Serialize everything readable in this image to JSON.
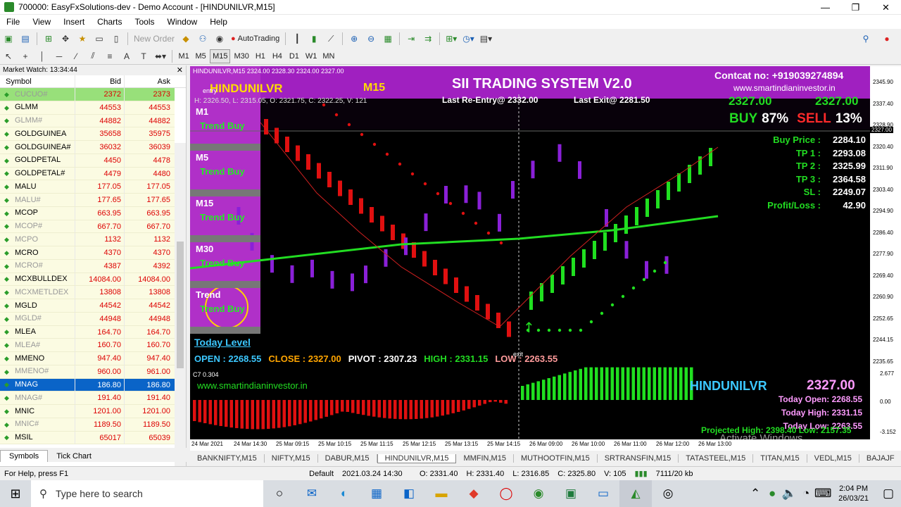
{
  "window": {
    "title": "700000: EasyFxSolutions-dev - Demo Account - [HINDUNILVR,M15]"
  },
  "menu": [
    "File",
    "View",
    "Insert",
    "Charts",
    "Tools",
    "Window",
    "Help"
  ],
  "toolbar": {
    "new_order": "New Order",
    "autotrading": "AutoTrading"
  },
  "timeframes": [
    "M1",
    "M5",
    "M15",
    "M30",
    "H1",
    "H4",
    "D1",
    "W1",
    "MN"
  ],
  "market_watch": {
    "title": "Market Watch: 13:34:44",
    "col_symbol": "Symbol",
    "col_bid": "Bid",
    "col_ask": "Ask",
    "rows": [
      {
        "s": "CUCUO#",
        "b": "2372",
        "a": "2373",
        "dim": true,
        "hl": true
      },
      {
        "s": "GLMM",
        "b": "44553",
        "a": "44553"
      },
      {
        "s": "GLMM#",
        "b": "44882",
        "a": "44882",
        "dim": true
      },
      {
        "s": "GOLDGUINEA",
        "b": "35658",
        "a": "35975"
      },
      {
        "s": "GOLDGUINEA#",
        "b": "36032",
        "a": "36039"
      },
      {
        "s": "GOLDPETAL",
        "b": "4450",
        "a": "4478"
      },
      {
        "s": "GOLDPETAL#",
        "b": "4479",
        "a": "4480"
      },
      {
        "s": "MALU",
        "b": "177.05",
        "a": "177.05"
      },
      {
        "s": "MALU#",
        "b": "177.65",
        "a": "177.65",
        "dim": true
      },
      {
        "s": "MCOP",
        "b": "663.95",
        "a": "663.95"
      },
      {
        "s": "MCOP#",
        "b": "667.70",
        "a": "667.70",
        "dim": true
      },
      {
        "s": "MCPO",
        "b": "1132",
        "a": "1132",
        "dim": true
      },
      {
        "s": "MCRO",
        "b": "4370",
        "a": "4370"
      },
      {
        "s": "MCRO#",
        "b": "4387",
        "a": "4392",
        "dim": true
      },
      {
        "s": "MCXBULLDEX",
        "b": "14084.00",
        "a": "14084.00"
      },
      {
        "s": "MCXMETLDEX",
        "b": "13808",
        "a": "13808",
        "dim": true
      },
      {
        "s": "MGLD",
        "b": "44542",
        "a": "44542"
      },
      {
        "s": "MGLD#",
        "b": "44948",
        "a": "44948",
        "dim": true
      },
      {
        "s": "MLEA",
        "b": "164.70",
        "a": "164.70"
      },
      {
        "s": "MLEA#",
        "b": "160.70",
        "a": "160.70",
        "dim": true
      },
      {
        "s": "MMENO",
        "b": "947.40",
        "a": "947.40"
      },
      {
        "s": "MMENO#",
        "b": "960.00",
        "a": "961.00",
        "dim": true
      },
      {
        "s": "MNAG",
        "b": "186.80",
        "a": "186.80",
        "sel": true
      },
      {
        "s": "MNAG#",
        "b": "191.40",
        "a": "191.40",
        "dim": true
      },
      {
        "s": "MNIC",
        "b": "1201.00",
        "a": "1201.00"
      },
      {
        "s": "MNIC#",
        "b": "1189.50",
        "a": "1189.50",
        "dim": true
      },
      {
        "s": "MSIL",
        "b": "65017",
        "a": "65039"
      }
    ],
    "tabs": [
      "Symbols",
      "Tick Chart"
    ]
  },
  "chart": {
    "header": "HINDUNILVR,M15 2324.00 2328.30 2324.00 2327.00",
    "symbol": "HINDUNILVR",
    "tf": "M15",
    "system": "SII TRADING SYSTEM V2.0",
    "contact": "Contcat no: +919039274894",
    "website": "www.smartindianinvestor.in",
    "ohlc": "H: 2326.50, L: 2315.05, O: 2321.75, C: 2322.25, V: 121",
    "reentry": "Last Re-Entry@ 2332.00",
    "exit": "Last Exit@ 2281.50",
    "price_left": "2327.00",
    "price_right": "2327.00",
    "buy_label": "BUY",
    "buy_pct": "87%",
    "sell_label": "SELL",
    "sell_pct": "13%",
    "trade": [
      {
        "k": "Buy Price :",
        "v": "2284.10"
      },
      {
        "k": "TP 1 :",
        "v": "2293.08"
      },
      {
        "k": "TP 2 :",
        "v": "2325.99"
      },
      {
        "k": "TP 3 :",
        "v": "2364.58"
      },
      {
        "k": "SL :",
        "v": "2249.07"
      },
      {
        "k": "Profit/Loss :",
        "v": "42.90"
      }
    ],
    "trend_panels": [
      {
        "tf": "M1",
        "t": "Trend Buy"
      },
      {
        "tf": "M5",
        "t": "Trend Buy"
      },
      {
        "tf": "M15",
        "t": "Trend Buy"
      },
      {
        "tf": "M30",
        "t": "Trend Buy"
      },
      {
        "tf": "Trend",
        "t": "Trend Buy"
      }
    ],
    "today_level": "Today Level",
    "open": "OPEN : 2268.55",
    "close": "CLOSE : 2327.00",
    "pivot": "PIVOT : 2307.23",
    "high": "HIGH : 2331.15",
    "low": "LOW : 2263.55",
    "entry_tag": "entry",
    "exit_tag": "exit",
    "sub_label": "C7 0.304",
    "sub_website": "www.smartindianinvestor.in",
    "sub_symbol": "HINDUNILVR",
    "sub_price": "2327.00",
    "today_open": "Today Open: 2268.55",
    "today_high": "Today High: 2331.15",
    "today_low": "Today Low: 2263.55",
    "projected": "Projected High: 2398.40  Low: 2157.35",
    "watermark": "Activate Windows",
    "price_ticks": [
      "2345.90",
      "2337.40",
      "2328.90",
      "2320.40",
      "2311.90",
      "2303.40",
      "2294.90",
      "2286.40",
      "2277.90",
      "2269.40",
      "2260.90",
      "2252.65",
      "2244.15",
      "2235.65"
    ],
    "price_current": "2327.00",
    "sub_ticks": [
      "2.677",
      "0.00",
      "-3.152"
    ],
    "time_ticks": [
      "24 Mar 2021",
      "24 Mar 14:30",
      "25 Mar 09:15",
      "25 Mar 10:15",
      "25 Mar 11:15",
      "25 Mar 12:15",
      "25 Mar 13:15",
      "25 Mar 14:15",
      "26 Mar 09:00",
      "26 Mar 10:00",
      "26 Mar 11:00",
      "26 Mar 12:00",
      "26 Mar 13:00"
    ]
  },
  "chart_tabs": [
    "BANKNIFTY,M15",
    "NIFTY,M15",
    "DABUR,M15",
    "HINDUNILVR,M15",
    "MMFIN,M15",
    "MUTHOOTFIN,M15",
    "SRTRANSFIN,M15",
    "TATASTEEL,M15",
    "TITAN,M15",
    "VEDL,M15",
    "BAJAJF"
  ],
  "status": {
    "help": "For Help, press F1",
    "profile": "Default",
    "dt": "2021.03.24 14:30",
    "o": "O: 2331.40",
    "h": "H: 2331.40",
    "l": "L: 2316.85",
    "c": "C: 2325.80",
    "v": "V: 105",
    "kb": "7111/20 kb"
  },
  "taskbar": {
    "search": "Type here to search",
    "time": "2:04 PM",
    "date": "26/03/21"
  }
}
